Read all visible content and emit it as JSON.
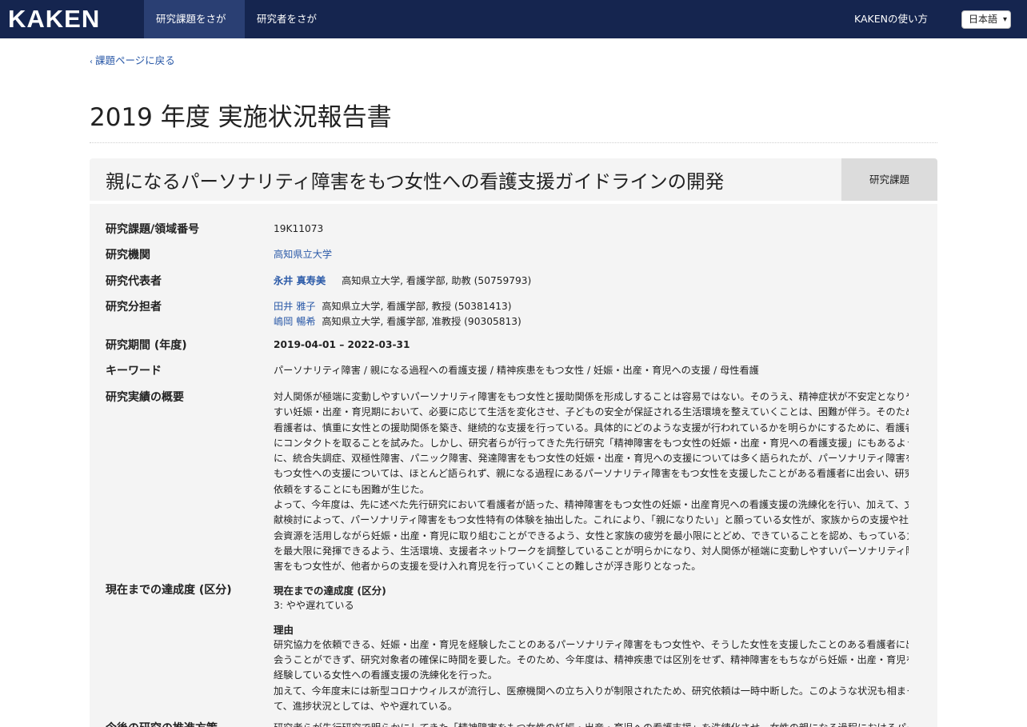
{
  "navbar": {
    "logo": "KAKEN",
    "tabs": [
      {
        "label": "研究課題をさがす",
        "active": true
      },
      {
        "label": "研究者をさがす",
        "active": false
      }
    ],
    "help": "KAKENの使い方",
    "language": "日本語"
  },
  "back_link": "課題ページに戻る",
  "page_title": "2019 年度 実施状況報告書",
  "project": {
    "title": "親になるパーソナリティ障害をもつ女性への看護支援ガイドラインの開発",
    "type_badge": "研究課題"
  },
  "fields": {
    "number": {
      "label": "研究課題/領域番号",
      "value": "19K11073"
    },
    "institution": {
      "label": "研究機関",
      "value": "高知県立大学"
    },
    "pi": {
      "label": "研究代表者",
      "name": "永井 真寿美",
      "affiliation": "高知県立大学, 看護学部, 助教 (50759793)"
    },
    "co": {
      "label": "研究分担者",
      "members": [
        {
          "name": "田井 雅子",
          "affiliation": "高知県立大学, 看護学部, 教授 (50381413)"
        },
        {
          "name": "嶋岡 暢希",
          "affiliation": "高知県立大学, 看護学部, 准教授 (90305813)"
        }
      ]
    },
    "period": {
      "label": "研究期間 (年度)",
      "value": "2019-04-01 – 2022-03-31"
    },
    "keywords": {
      "label": "キーワード",
      "value": "パーソナリティ障害 / 親になる過程への看護支援 / 精神疾患をもつ女性 / 妊娠・出産・育児への支援 / 母性看護"
    },
    "summary": {
      "label": "研究実績の概要",
      "lines": [
        "対人関係が極端に変動しやすいパーソナリティ障害をもつ女性と援助関係を形成しすることは容易ではない。そのうえ、精神症状が不安定となりや",
        "すい妊娠・出産・育児期において、必要に応じて生活を変化させ、子どもの安全が保証される生活環境を整えていくことは、困難が伴う。そのため",
        "看護者は、慎重に女性との援助関係を築き、継続的な支援を行っている。具体的にどのような支援が行われているかを明らかにするために、看護者",
        "にコンタクトを取ることを試みた。しかし、研究者らが行ってきた先行研究「精神障害をもつ女性の妊娠・出産・育児への看護支援」にもあるよう",
        "に、統合失調症、双極性障害、パニック障害、発達障害をもつ女性の妊娠・出産・育児への支援については多く語られたが、パーソナリティ障害を",
        "もつ女性への支援については、ほとんど語られず、親になる過程にあるパーソナリティ障害をもつ女性を支援したことがある看護者に出会い、研究",
        "依頼をすることにも困難が生じた。",
        "よって、今年度は、先に述べた先行研究において看護者が語った、精神障害をもつ女性の妊娠・出産育児への看護支援の洗練化を行い、加えて、文",
        "献検討によって、パーソナリティ障害をもつ女性特有の体験を抽出した。これにより、「親になりたい」と願っている女性が、家族からの支援や社",
        "会資源を活用しながら妊娠・出産・育児に取り組むことができるよう、女性と家族の疲労を最小限にとどめ、できていることを認め、もっている力",
        "を最大限に発揮できるよう、生活環境、支援者ネットワークを調整していることが明らかになり、対人関係が極端に変動しやすいパーソナリティ障",
        "害をもつ女性が、他者からの支援を受け入れ育児を行っていくことの難しさが浮き彫りとなった。"
      ]
    },
    "progress": {
      "label": "現在までの達成度 (区分)",
      "subhead": "現在までの達成度 (区分)",
      "value": "3: やや遅れている",
      "reason_head": "理由",
      "reason_lines": [
        "研究協力を依頼できる、妊娠・出産・育児を経験したことのあるパーソナリティ障害をもつ女性や、そうした女性を支援したことのある看護者に出",
        "会うことができず、研究対象者の確保に時間を要した。そのため、今年度は、精神疾患では区別をせず、精神障害をもちながら妊娠・出産・育児を",
        "経験している女性への看護支援の洗練化を行った。",
        "加えて、今年度末には新型コロナウィルスが流行し、医療機関への立ち入りが制限されたため、研究依頼は一時中断した。このような状況も相まっ",
        "て、進捗状況としては、やや遅れている。"
      ]
    },
    "next": {
      "label": "今後の研究の推進方策",
      "line": "研究者らが先行研究で明らかにしてきた「精神障害をもつ女性の妊娠・出産・育児への看護支援」を洗練化させ、女性の親になる過程におけるパーソ"
    }
  }
}
